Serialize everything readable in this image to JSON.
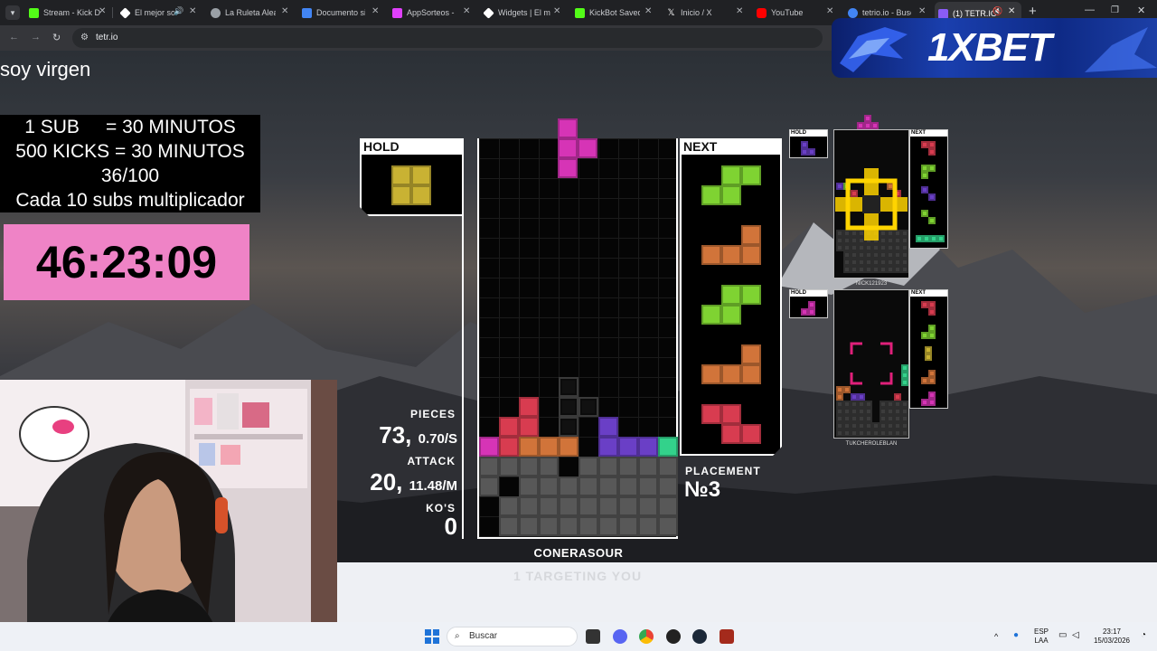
{
  "browser": {
    "tabs": [
      {
        "label": "Stream - Kick D",
        "color": "#53fc18"
      },
      {
        "label": "El mejor so",
        "color": "#ffffff"
      },
      {
        "label": "La Ruleta Alea",
        "color": "#9aa0a6"
      },
      {
        "label": "Documento sin",
        "color": "#4285f4"
      },
      {
        "label": "AppSorteos - I",
        "color": "#e040fb"
      },
      {
        "label": "Widgets | El m",
        "color": "#ffffff"
      },
      {
        "label": "KickBot Saved",
        "color": "#53fc18"
      },
      {
        "label": "Inicio / X",
        "color": "#ffffff"
      },
      {
        "label": "YouTube",
        "color": "#ff0000"
      },
      {
        "label": "tetrio.io - Busc",
        "color": "#4285f4"
      },
      {
        "label": "(1) TETR.IO",
        "color": "#8a5cf6"
      }
    ],
    "new_tab": "+",
    "url": "tetr.io"
  },
  "stream": {
    "status_text": "soy virgen",
    "subs_lines": [
      "1 SUB     = 30 MINUTOS",
      "500 KICKS = 30 MINUTOS",
      "36/100",
      "Cada 10 subs multiplicador"
    ],
    "timer": "46:23:09"
  },
  "game": {
    "hold_label": "HOLD",
    "next_label": "NEXT",
    "pieces_label": "PIECES",
    "pieces_value": "73,",
    "pieces_rate": "0.70/S",
    "attack_label": "ATTACK",
    "attack_value": "20,",
    "attack_rate": "11.48/M",
    "kos_label": "KO'S",
    "kos_value": "0",
    "placement_label": "PLACEMENT",
    "placement_value": "№3",
    "player_name": "CONERASOUR",
    "targeting_text": "1 TARGETING YOU",
    "opponents": [
      {
        "hold_label": "HOLD",
        "next_label": "NEXT",
        "name": "NICK121923"
      },
      {
        "hold_label": "HOLD",
        "next_label": "NEXT",
        "name": "TUKCHEROLEBLAN"
      }
    ]
  },
  "ad": {
    "brand": "1XBET"
  },
  "taskbar": {
    "search_placeholder": "Buscar",
    "lang_top": "ESP",
    "lang_bottom": "LAA",
    "time": "23:17",
    "date": "15/03/2026"
  },
  "colors": {
    "o_piece": "#c9b233",
    "s_piece": "#7fd332",
    "l_piece": "#d1743a",
    "z_piece": "#d83c50",
    "t_piece": "#d634b6",
    "j_piece": "#6a3fc6",
    "i_piece": "#33d28b",
    "garbage": "#585858",
    "timer_bg": "#ef83c6"
  }
}
